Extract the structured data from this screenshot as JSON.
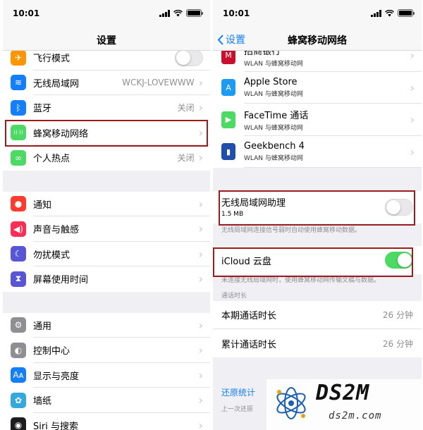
{
  "left": {
    "status": {
      "time": "10:01"
    },
    "title": "设置",
    "groups": [
      [
        {
          "icon": "airplane-icon",
          "color": "#ff9500",
          "label": "飞行模式",
          "toggle": "off"
        },
        {
          "icon": "wifi-icon",
          "color": "#147efb",
          "label": "无线局域网",
          "value": "WCKJ-LOVEWWW"
        },
        {
          "icon": "bluetooth-icon",
          "color": "#147efb",
          "label": "蓝牙",
          "value": "关闭"
        },
        {
          "icon": "cellular-icon",
          "color": "#4cd964",
          "label": "蜂窝移动网络"
        },
        {
          "icon": "hotspot-icon",
          "color": "#4cd964",
          "label": "个人热点",
          "value": "关闭"
        }
      ],
      [
        {
          "icon": "notifications-icon",
          "color": "#ff3b30",
          "label": "通知"
        },
        {
          "icon": "sounds-icon",
          "color": "#ff2d55",
          "label": "声音与触感"
        },
        {
          "icon": "moon-icon",
          "color": "#5856d6",
          "label": "勿扰模式"
        },
        {
          "icon": "hourglass-icon",
          "color": "#5856d6",
          "label": "屏幕使用时间"
        }
      ],
      [
        {
          "icon": "gear-icon",
          "color": "#8e8e93",
          "label": "通用"
        },
        {
          "icon": "control-center-icon",
          "color": "#8e8e93",
          "label": "控制中心"
        },
        {
          "icon": "display-icon",
          "color": "#147efb",
          "label": "显示与亮度"
        },
        {
          "icon": "wallpaper-icon",
          "color": "#34aadc",
          "label": "墙纸"
        },
        {
          "icon": "siri-icon",
          "color": "#1c1c1e",
          "label": "Siri 与搜索"
        }
      ]
    ]
  },
  "right": {
    "status": {
      "time": "10:01"
    },
    "back_label": "设置",
    "title": "蜂窝移动网络",
    "apps": [
      {
        "icon": "cmb-bank-icon",
        "color": "#c8102e",
        "name": "招商银行",
        "sub": "WLAN 与蜂窝移动网"
      },
      {
        "icon": "app-store-icon",
        "color": "#1d9bf0",
        "name": "Apple Store",
        "sub": "WLAN 与蜂窝移动网"
      },
      {
        "icon": "facetime-icon",
        "color": "#4cd964",
        "name": "FaceTime 通话",
        "sub": "WLAN 与蜂窝移动网"
      },
      {
        "icon": "geekbench-icon",
        "color": "#1f4fa8",
        "name": "Geekbench 4",
        "sub": "WLAN 与蜂窝移动网"
      }
    ],
    "wifi_assist": {
      "label": "无线局域网助理",
      "size": "1.5 MB",
      "toggle": "off",
      "footer": "无线局域网连接信号弱时自动使用蜂窝移动数据。"
    },
    "icloud": {
      "label": "iCloud 云盘",
      "toggle": "on",
      "footer": "未连接无线局域网时，使用蜂窝移动网传输文稿与数据。"
    },
    "call_time": {
      "header": "通话时长",
      "rows": [
        {
          "label": "本期通话时长",
          "value": "26 分钟"
        },
        {
          "label": "累计通话时长",
          "value": "26 分钟"
        }
      ]
    },
    "reset_label": "还原统计",
    "last_reset_label": "上一次还原"
  },
  "watermark": {
    "big": "DS2M",
    "small": "ds2m.com"
  },
  "colors": {
    "accent": "#147efb",
    "highlight": "#9b1c1c",
    "toggle_on": "#4cd964"
  }
}
